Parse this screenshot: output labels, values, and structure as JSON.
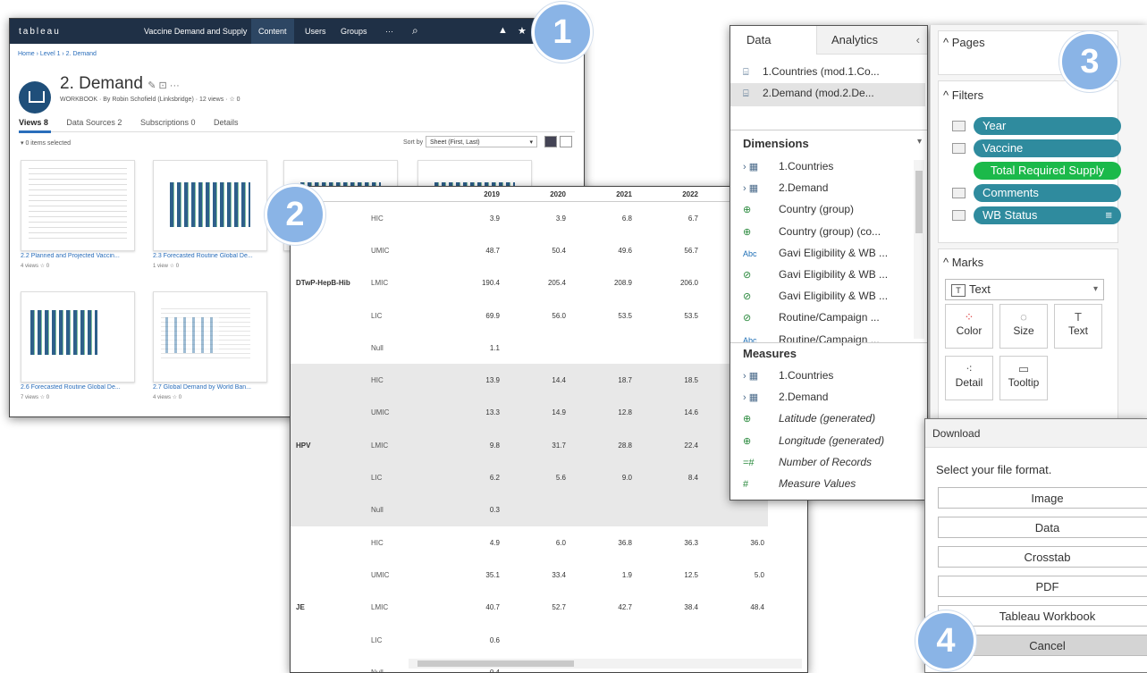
{
  "server": {
    "brand": "tableau",
    "project": "Vaccine Demand and Supply",
    "nav": [
      "Content",
      "Users",
      "Groups",
      "···"
    ],
    "breadcrumb": "Home › Level 1 › 2. Demand",
    "title": "2. Demand",
    "meta": "WORKBOOK · By Robin Schofield (Linksbridge) · 12 views · ☆ 0",
    "tabs": [
      "Views 8",
      "Data Sources 2",
      "Subscriptions 0",
      "Details"
    ],
    "selection": "▾ 0 items selected",
    "sort_label": "Sort by",
    "sort_value": "Sheet (First, Last)",
    "thumbnails": [
      {
        "label": "2.2 Planned and Projected Vaccin...",
        "views": "4 views   ☆ 0"
      },
      {
        "label": "2.3 Forecasted Routine Global De...",
        "views": "1 view   ☆ 0"
      },
      {
        "label": "2.6 Forecasted Routine Global De...",
        "views": "7 views   ☆ 0"
      },
      {
        "label": "2.7 Global Demand by World Ban...",
        "views": "4 views   ☆ 0"
      }
    ]
  },
  "crosstab": {
    "years": [
      "2019",
      "2020",
      "2021",
      "2022",
      ""
    ],
    "rows": [
      {
        "group": "",
        "cls": "HIC",
        "v": [
          "3.9",
          "3.9",
          "6.8",
          "6.7",
          ""
        ],
        "gray": false
      },
      {
        "group": "",
        "cls": "UMIC",
        "v": [
          "48.7",
          "50.4",
          "49.6",
          "56.7",
          ""
        ],
        "gray": false
      },
      {
        "group": "DTwP-HepB-Hib",
        "cls": "LMIC",
        "v": [
          "190.4",
          "205.4",
          "208.9",
          "206.0",
          ""
        ],
        "gray": false
      },
      {
        "group": "",
        "cls": "LIC",
        "v": [
          "69.9",
          "56.0",
          "53.5",
          "53.5",
          ""
        ],
        "gray": false
      },
      {
        "group": "",
        "cls": "Null",
        "v": [
          "1.1",
          "",
          "",
          "",
          ""
        ],
        "gray": false
      },
      {
        "group": "",
        "cls": "HIC",
        "v": [
          "13.9",
          "14.4",
          "18.7",
          "18.5",
          ""
        ],
        "gray": true
      },
      {
        "group": "",
        "cls": "UMIC",
        "v": [
          "13.3",
          "14.9",
          "12.8",
          "14.6",
          ""
        ],
        "gray": true
      },
      {
        "group": "HPV",
        "cls": "LMIC",
        "v": [
          "9.8",
          "31.7",
          "28.8",
          "22.4",
          ""
        ],
        "gray": true
      },
      {
        "group": "",
        "cls": "LIC",
        "v": [
          "6.2",
          "5.6",
          "9.0",
          "8.4",
          ""
        ],
        "gray": true
      },
      {
        "group": "",
        "cls": "Null",
        "v": [
          "0.3",
          "",
          "",
          "",
          ""
        ],
        "gray": true
      },
      {
        "group": "",
        "cls": "HIC",
        "v": [
          "4.9",
          "6.0",
          "36.8",
          "36.3",
          "36.0"
        ],
        "gray": false
      },
      {
        "group": "",
        "cls": "UMIC",
        "v": [
          "35.1",
          "33.4",
          "1.9",
          "12.5",
          "5.0"
        ],
        "gray": false
      },
      {
        "group": "JE",
        "cls": "LMIC",
        "v": [
          "40.7",
          "52.7",
          "42.7",
          "38.4",
          "48.4"
        ],
        "gray": false
      },
      {
        "group": "",
        "cls": "LIC",
        "v": [
          "0.6",
          "",
          "",
          "",
          ""
        ],
        "gray": false
      },
      {
        "group": "",
        "cls": "Null",
        "v": [
          "0.4",
          "",
          "",
          "",
          ""
        ],
        "gray": false
      }
    ]
  },
  "datapane": {
    "tab_data": "Data",
    "tab_analytics": "Analytics",
    "sources": [
      "1.Countries (mod.1.Co...",
      "2.Demand (mod.2.De..."
    ],
    "dimensions_title": "Dimensions",
    "dimensions": [
      {
        "icon": "›  ▦",
        "label": "1.Countries",
        "italic": false
      },
      {
        "icon": "›  ▦",
        "label": "2.Demand",
        "italic": false
      },
      {
        "icon": "⊕",
        "label": "Country (group)",
        "italic": false
      },
      {
        "icon": "⊕",
        "label": "Country (group) (co...",
        "italic": false
      },
      {
        "icon": "Abc",
        "label": "Gavi Eligibility & WB ...",
        "italic": false
      },
      {
        "icon": "⊘",
        "label": "Gavi Eligibility & WB ...",
        "italic": false
      },
      {
        "icon": "⊘",
        "label": "Gavi Eligibility & WB ...",
        "italic": false
      },
      {
        "icon": "⊘",
        "label": "Routine/Campaign ...",
        "italic": false
      },
      {
        "icon": "Abc",
        "label": "Routine/Campaign ...",
        "italic": false
      }
    ],
    "measures_title": "Measures",
    "measures": [
      {
        "icon": "›  ▦",
        "label": "1.Countries",
        "italic": false
      },
      {
        "icon": "›  ▦",
        "label": "2.Demand",
        "italic": false
      },
      {
        "icon": "⊕",
        "label": "Latitude (generated)",
        "italic": true
      },
      {
        "icon": "⊕",
        "label": "Longitude (generated)",
        "italic": true
      },
      {
        "icon": "=#",
        "label": "Number of Records",
        "italic": true
      },
      {
        "icon": "#",
        "label": "Measure Values",
        "italic": true
      }
    ]
  },
  "shelves": {
    "pages": "Pages",
    "filters": "Filters",
    "filter_pills": [
      "Year",
      "Vaccine",
      "Total Required Supply",
      "Comments",
      "WB Status"
    ],
    "marks": "Marks",
    "mark_type": "Text",
    "mark_buttons": [
      "Color",
      "Size",
      "Text",
      "Detail",
      "Tooltip"
    ]
  },
  "download": {
    "title": "Download",
    "message": "Select your file format.",
    "options": [
      "Image",
      "Data",
      "Crosstab",
      "PDF",
      "Tableau Workbook"
    ],
    "cancel": "Cancel"
  },
  "badges": [
    "1",
    "2",
    "3",
    "4"
  ]
}
